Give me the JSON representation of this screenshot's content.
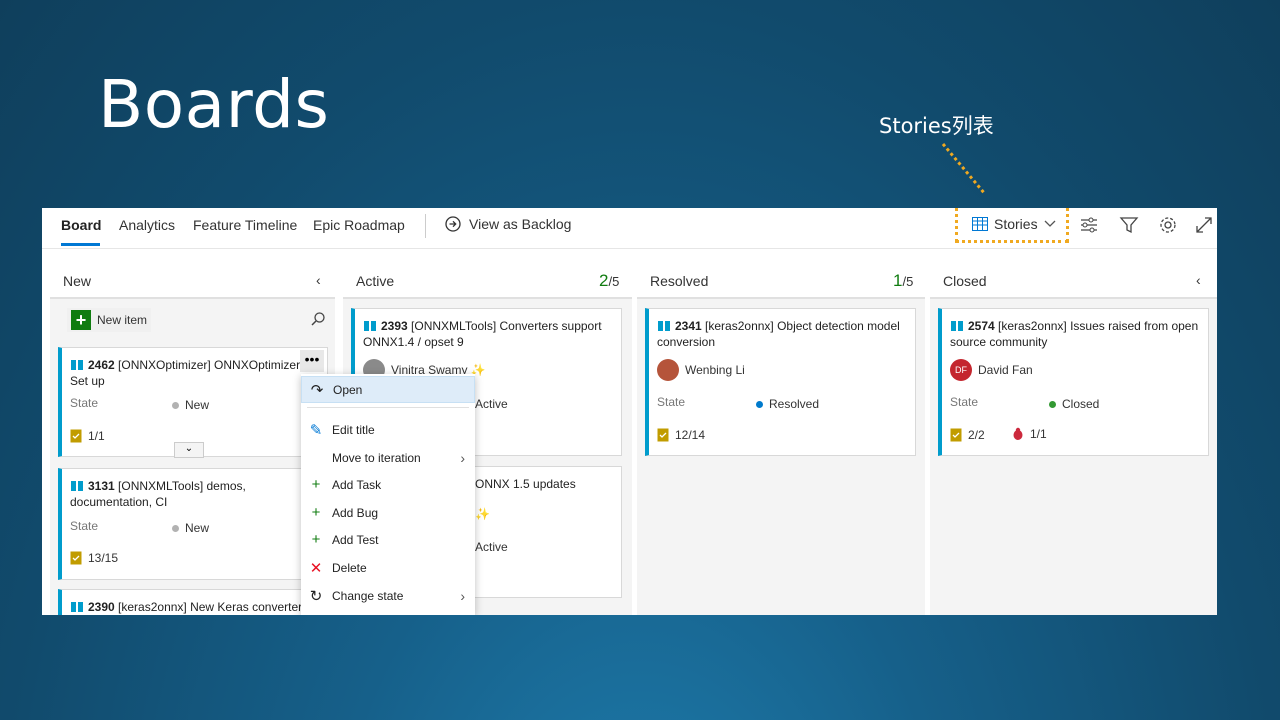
{
  "slide": {
    "title": "Boards",
    "callout": "Stories列表"
  },
  "topbar": {
    "tabs": [
      {
        "label": "Board",
        "active": true
      },
      {
        "label": "Analytics"
      },
      {
        "label": "Feature Timeline"
      },
      {
        "label": "Epic Roadmap"
      }
    ],
    "backlog_label": "View as Backlog",
    "level_selector": "Stories"
  },
  "new_item_label": "New item",
  "columns": [
    {
      "name": "New",
      "count": "",
      "limit": ""
    },
    {
      "name": "Active",
      "count": "2",
      "limit": "/5"
    },
    {
      "name": "Resolved",
      "count": "1",
      "limit": "/5"
    },
    {
      "name": "Closed",
      "count": "",
      "limit": ""
    }
  ],
  "cards": {
    "c2462": {
      "id": "2462",
      "title": "[ONNXOptimizer] ONNXOptimizer",
      "title2": "Set up",
      "state_label": "State",
      "state": "New",
      "metric": "1/1"
    },
    "c3131": {
      "id": "3131",
      "title": "[ONNXMLTools] demos,",
      "title2": "documentation, CI",
      "state_label": "State",
      "state": "New",
      "metric": "13/15"
    },
    "c2390": {
      "id": "2390",
      "title": "[keras2onnx] New Keras converter"
    },
    "c2393": {
      "id": "2393",
      "title": "[ONNXMLTools] Converters support",
      "title2": "ONNX1.4 / opset 9",
      "person": "Vinitra Swamy ✨",
      "state": "Active"
    },
    "cActive2": {
      "title": "ONNX 1.5 updates",
      "person": "✨",
      "state": "Active"
    },
    "c2341": {
      "id": "2341",
      "title": "[keras2onnx] Object detection model",
      "title2": "conversion",
      "person": "Wenbing Li",
      "state_label": "State",
      "state": "Resolved",
      "metric": "12/14"
    },
    "c2574": {
      "id": "2574",
      "title": "[keras2onnx] Issues raised from open",
      "title2": "source community",
      "person": "David Fan",
      "person_initials": "DF",
      "state_label": "State",
      "state": "Closed",
      "metric": "2/2",
      "metric2": "1/1"
    }
  },
  "context_menu": [
    {
      "label": "Open",
      "icon": "open-icon"
    },
    {
      "label": "Edit title",
      "icon": "pencil-icon"
    },
    {
      "label": "Move to iteration",
      "icon": "",
      "submenu": true
    },
    {
      "label": "Add Task",
      "icon": "plus-icon"
    },
    {
      "label": "Add Bug",
      "icon": "plus-icon"
    },
    {
      "label": "Add Test",
      "icon": "plus-icon"
    },
    {
      "label": "Delete",
      "icon": "delete-icon"
    },
    {
      "label": "Change state",
      "icon": "refresh-icon",
      "submenu": true
    }
  ],
  "colors": {
    "accent": "#0078d4",
    "story": "#009ccc",
    "callout": "#f0a920",
    "green": "#107c10",
    "red": "#e81123"
  }
}
